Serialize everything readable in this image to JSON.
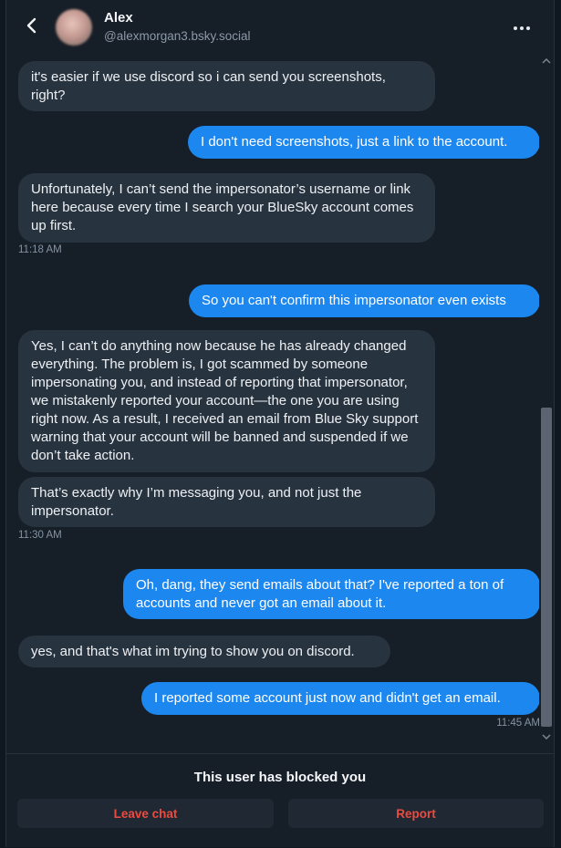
{
  "header": {
    "name": "Alex",
    "handle": "@alexmorgan3.bsky.social",
    "back_icon": "chevron-left-icon",
    "more_icon": "ellipsis-icon"
  },
  "messages": [
    {
      "side": "in",
      "text": "it's easier if we use discord so i can send you screenshots, right?"
    },
    {
      "side": "out",
      "text": "I don't need screenshots, just a link to the account."
    },
    {
      "side": "in",
      "text": "Unfortunately, I can’t send the impersonator’s username or link here because every time I search your BlueSky account comes up first."
    },
    {
      "side": "time",
      "text": "11:18 AM"
    },
    {
      "side": "out",
      "text": "So you can't confirm this impersonator even exists"
    },
    {
      "side": "in",
      "text": "Yes, I can’t do anything now because he has already changed everything. The problem is, I got scammed by someone impersonating you, and instead of reporting that impersonator, we mistakenly reported your account—the one you are using right now. As a result, I received an email from Blue Sky support warning that your account will be banned and suspended if we don’t take action."
    },
    {
      "side": "in",
      "text": "That’s exactly why I’m messaging you, and not just the impersonator."
    },
    {
      "side": "time",
      "text": "11:30 AM"
    },
    {
      "side": "out",
      "text": "Oh, dang, they send emails about that? I've reported a ton of accounts and never got an email about it."
    },
    {
      "side": "in",
      "text": "yes, and that's what im trying to show you on discord."
    },
    {
      "side": "out",
      "text": "I reported some account just now and didn't get an email."
    },
    {
      "side": "time",
      "text": "11:45 AM"
    }
  ],
  "footer": {
    "blocked_text": "This user has blocked you",
    "leave_label": "Leave chat",
    "report_label": "Report"
  },
  "colors": {
    "outgoing_bubble": "#1d87f0",
    "incoming_bubble": "#283340",
    "danger": "#ec4b3f",
    "background": "#161e27"
  }
}
